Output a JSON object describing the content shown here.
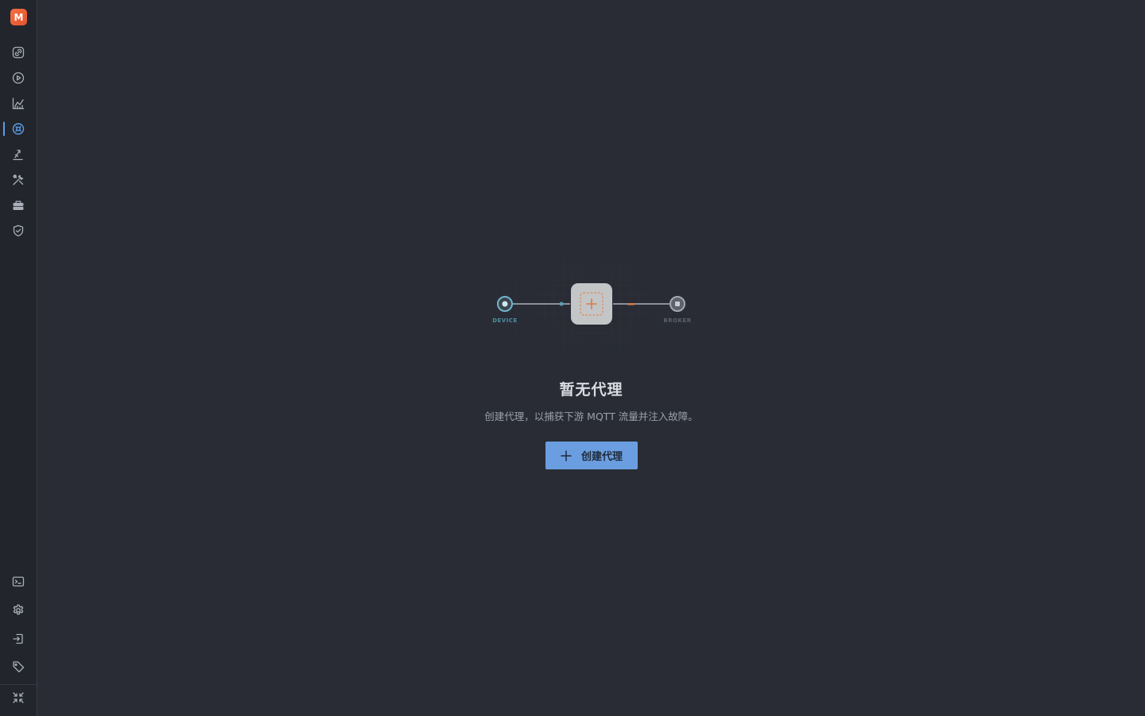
{
  "app": {
    "logo_letter": "M",
    "accent_color": "#5d9ee8",
    "brand_color": "#f05a30"
  },
  "sidebar": {
    "top_items": [
      {
        "id": "connections",
        "icon": "link-icon"
      },
      {
        "id": "run",
        "icon": "play-circle-icon"
      },
      {
        "id": "metrics",
        "icon": "chart-icon"
      },
      {
        "id": "proxy",
        "icon": "proxy-icon",
        "active": true
      },
      {
        "id": "publish",
        "icon": "publish-icon"
      },
      {
        "id": "tools",
        "icon": "tools-icon"
      },
      {
        "id": "toolbox",
        "icon": "briefcase-icon"
      },
      {
        "id": "security",
        "icon": "shield-check-icon"
      }
    ],
    "bottom_items": [
      {
        "id": "terminal",
        "icon": "terminal-icon"
      },
      {
        "id": "settings",
        "icon": "gear-icon"
      },
      {
        "id": "import",
        "icon": "login-icon"
      },
      {
        "id": "tags",
        "icon": "tag-icon"
      },
      {
        "id": "collapse",
        "icon": "collapse-icon"
      }
    ]
  },
  "empty_state": {
    "illustration": {
      "left_label": "DEVICE",
      "right_label": "BROKER"
    },
    "title": "暂无代理",
    "description": "创建代理，以捕获下游 MQTT 流量并注入故障。",
    "button_label": "创建代理"
  }
}
